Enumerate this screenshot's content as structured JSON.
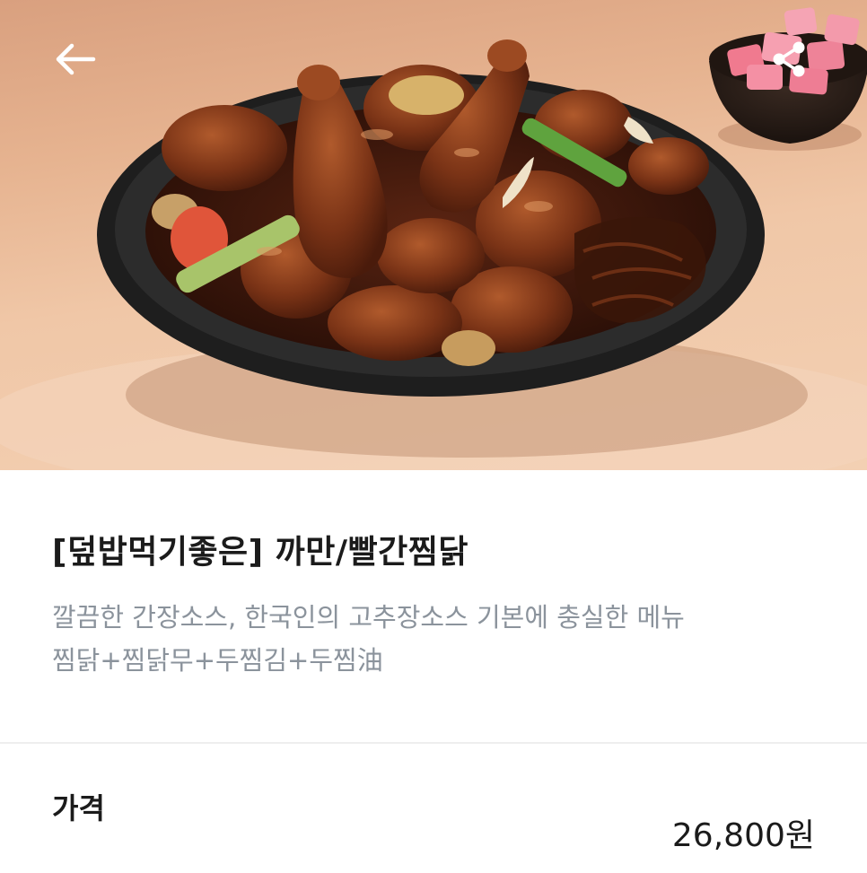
{
  "header": {
    "back_icon": "arrow-left-icon",
    "share_icon": "share-icon"
  },
  "menu": {
    "title": "[덮밥먹기좋은] 까만/빨간찜닭",
    "description_line1": "깔끔한 간장소스, 한국인의 고추장소스 기본에 충실한 메뉴",
    "description_line2": "찜닭+찜닭무+두찜김+두찜油"
  },
  "price": {
    "label": "가격",
    "value": "26,800원"
  },
  "colors": {
    "hero_background": "#ecbd9b",
    "title_text": "#1b1b1b",
    "description_text": "#8b939c",
    "divider": "#eeeeee"
  }
}
